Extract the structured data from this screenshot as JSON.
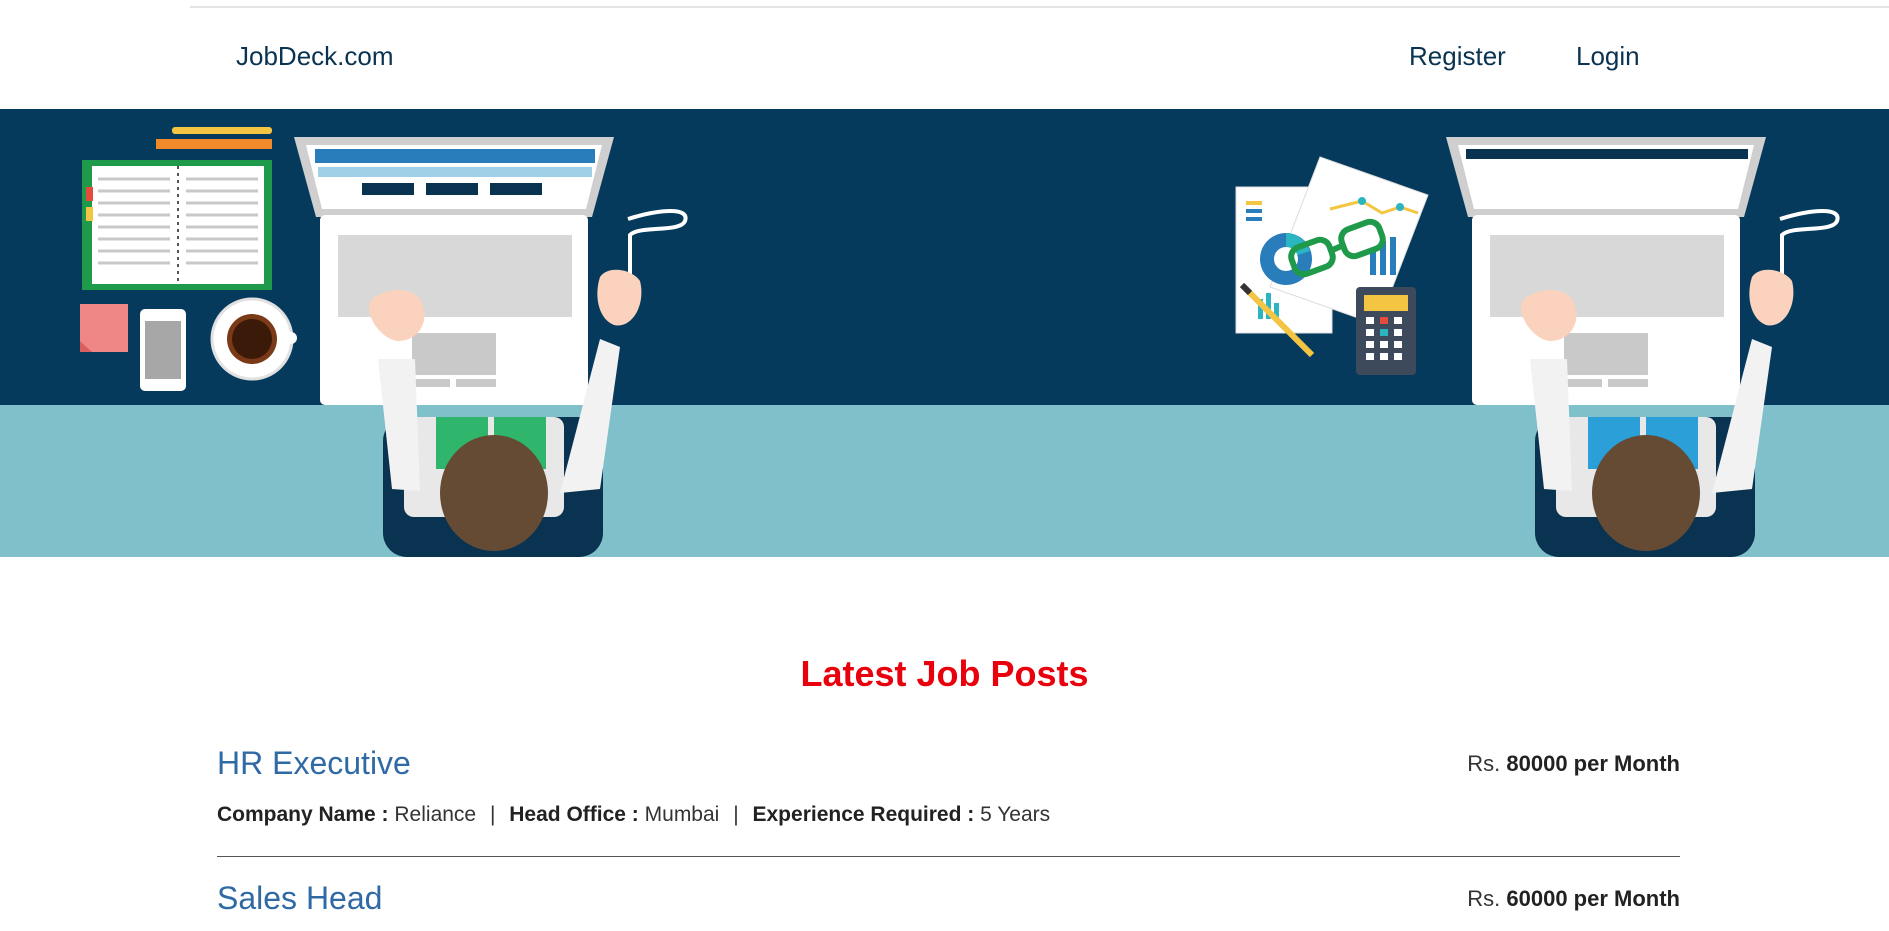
{
  "nav": {
    "brand": "JobDeck.com",
    "register": "Register",
    "login": "Login"
  },
  "hero": {
    "colors": {
      "wall": "#063a5c",
      "desk": "#7fc0ca"
    }
  },
  "section": {
    "title": "Latest Job Posts"
  },
  "labels": {
    "company": "Company Name :",
    "office": "Head Office :",
    "experience": "Experience Required :",
    "currency": "Rs.",
    "separator": "|"
  },
  "jobs": [
    {
      "title": "HR Executive",
      "salary": "80000 per Month",
      "company": "Reliance",
      "office": "Mumbai",
      "experience": "5 Years"
    },
    {
      "title": "Sales Head",
      "salary": "60000 per Month"
    }
  ],
  "colors": {
    "accent": "#e8000d",
    "link": "#2f6aa5",
    "navy": "#0a3352"
  }
}
